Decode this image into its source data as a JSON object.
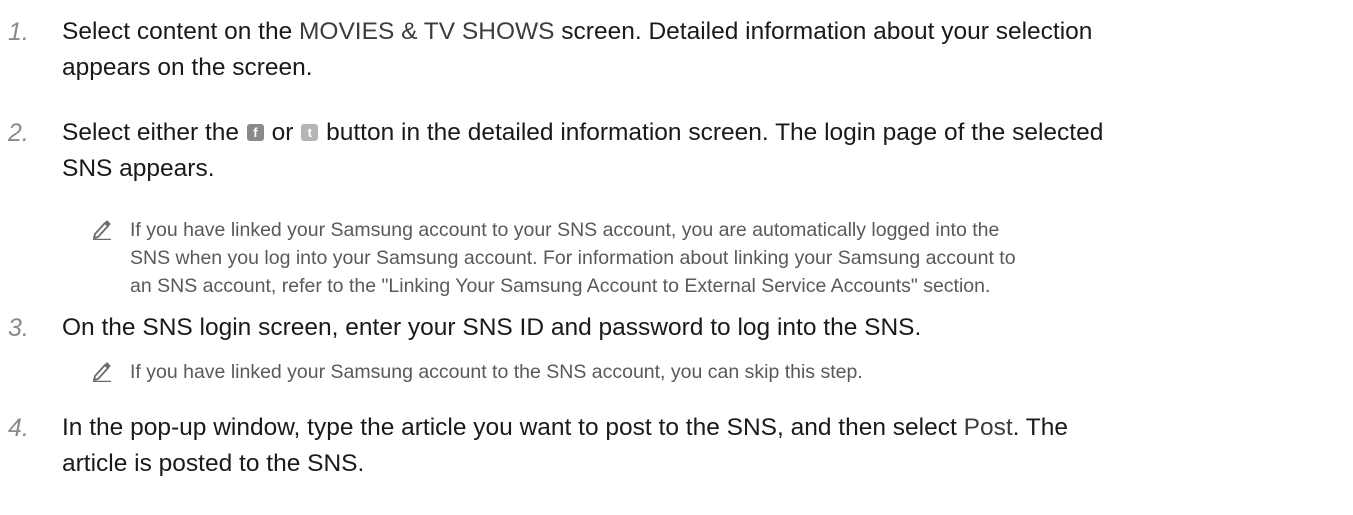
{
  "steps": [
    {
      "number": "1.",
      "text_a": "Select content on the ",
      "emph": "MOVIES & TV SHOWS",
      "text_b": " screen. Detailed information about your selection",
      "line2": "appears on the screen."
    },
    {
      "number": "2.",
      "text_a": "Select either the ",
      "mid": " or ",
      "text_b": " button in the detailed information screen. The login page of the selected",
      "line2": "SNS appears."
    },
    {
      "number": "3.",
      "text": "On the SNS login screen, enter your SNS ID and password to log into the SNS."
    },
    {
      "number": "4.",
      "text_a": "In the pop-up window, type the article you want to post to the SNS, and then select ",
      "emph": "Post",
      "text_b": ". The",
      "line2": "article is posted to the SNS."
    }
  ],
  "notes": [
    {
      "icon": "pencil-icon",
      "line1": "If you have linked your Samsung account to your SNS account, you are automatically logged into the",
      "line2": "SNS when you log into your Samsung account. For information about linking your Samsung account to",
      "line3": "an SNS account, refer to the \"Linking Your Samsung Account to External Service Accounts\" section."
    },
    {
      "icon": "pencil-icon",
      "line1": "If you have linked your Samsung account to the SNS account, you can skip this step."
    }
  ],
  "buttons": {
    "facebook_icon": "facebook-icon",
    "facebook_glyph": "f",
    "twitter_icon": "twitter-icon",
    "twitter_glyph": "t"
  }
}
